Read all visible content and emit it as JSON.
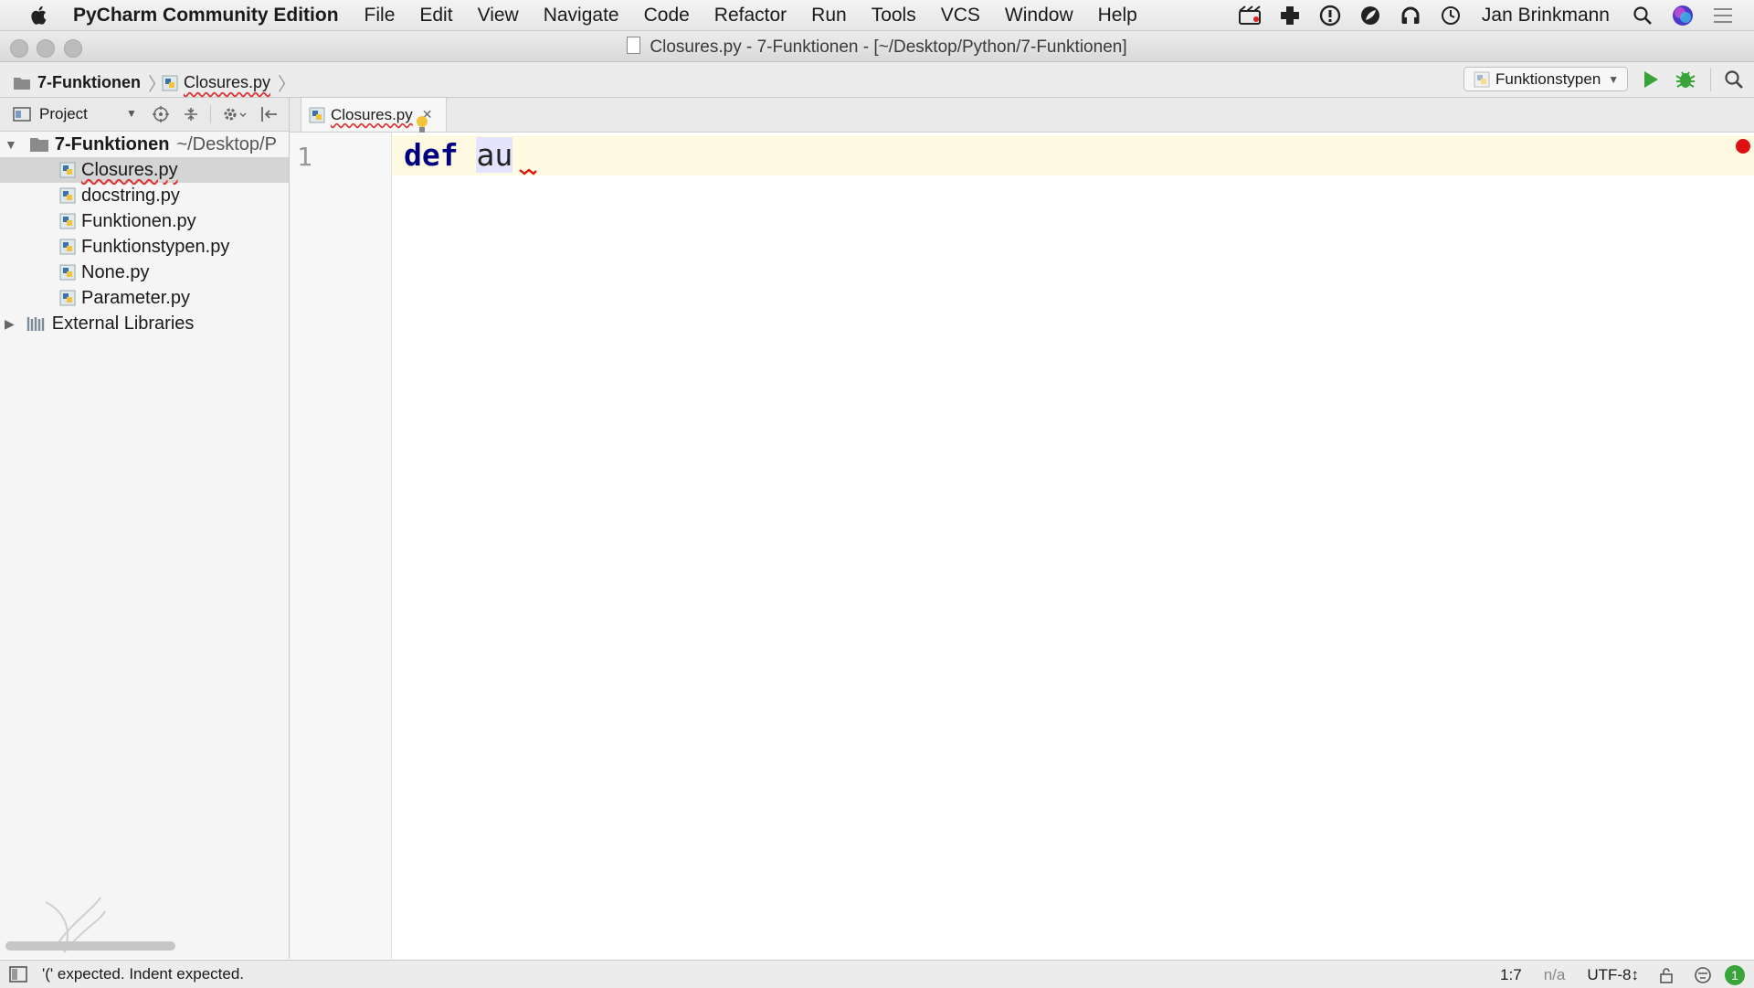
{
  "menubar": {
    "app_name": "PyCharm Community Edition",
    "items": [
      "File",
      "Edit",
      "View",
      "Navigate",
      "Code",
      "Refactor",
      "Run",
      "Tools",
      "VCS",
      "Window",
      "Help"
    ],
    "user_name": "Jan Brinkmann",
    "status_icons": [
      "film-icon",
      "plus-cross-icon",
      "info-circle-icon",
      "leaf-icon",
      "headphones-icon",
      "clock-icon"
    ]
  },
  "window": {
    "title": "Closures.py - 7-Funktionen - [~/Desktop/Python/7-Funktionen]"
  },
  "breadcrumb": {
    "project": "7-Funktionen",
    "file": "Closures.py"
  },
  "run_config": {
    "label": "Funktionstypen"
  },
  "project_panel": {
    "title": "Project",
    "root": {
      "name": "7-Funktionen",
      "path": "~/Desktop/P"
    },
    "files": [
      "Closures.py",
      "docstring.py",
      "Funktionen.py",
      "Funktionstypen.py",
      "None.py",
      "Parameter.py"
    ],
    "selected_file": "Closures.py",
    "external": "External Libraries"
  },
  "editor": {
    "tab_label": "Closures.py",
    "line_number": "1",
    "keyword": "def",
    "identifier": "au"
  },
  "statusbar": {
    "message": "'(' expected. Indent expected.",
    "position": "1:7",
    "na": "n/a",
    "encoding": "UTF-8↕",
    "notification_count": "1"
  },
  "colors": {
    "keyword": "#000080",
    "run_green": "#3aa43a",
    "error_red": "#d11111",
    "current_line": "#fffbe3"
  }
}
